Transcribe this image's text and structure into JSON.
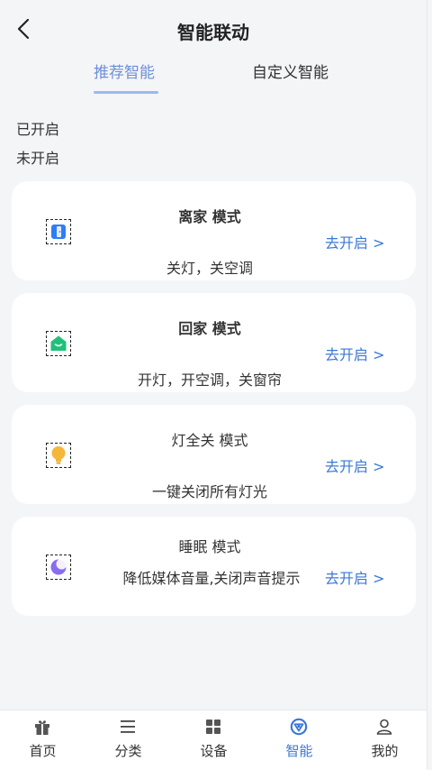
{
  "header": {
    "title": "智能联动",
    "back_icon": "chevron-left-icon"
  },
  "tabs": [
    {
      "label": "推荐智能",
      "active": true
    },
    {
      "label": "自定义智能",
      "active": false
    }
  ],
  "status": {
    "enabled": "已开启",
    "disabled": "未开启"
  },
  "modes": [
    {
      "name": "离家 模式",
      "desc": "关灯，关空调",
      "cta": "去开启 >",
      "icon": "exit-door-icon",
      "color": "#2f7df6"
    },
    {
      "name": "回家 模式",
      "desc": "开灯，开空调，关窗帘",
      "cta": "去开启 >",
      "icon": "home-icon",
      "color": "#21c07a"
    },
    {
      "name": "灯全关 模式",
      "desc": "一键关闭所有灯光",
      "cta": "去开启 >",
      "icon": "lightbulb-icon",
      "color": "#f5b63a"
    },
    {
      "name": "睡眠 模式",
      "desc": "降低媒体音量,关闭声音提示",
      "cta": "去开启 >",
      "icon": "moon-icon",
      "color": "#8a6cf0"
    }
  ],
  "tabbar": [
    {
      "label": "首页",
      "icon": "gift-icon",
      "active": false
    },
    {
      "label": "分类",
      "icon": "menu-icon",
      "active": false
    },
    {
      "label": "设备",
      "icon": "grid-icon",
      "active": false
    },
    {
      "label": "智能",
      "icon": "smart-icon",
      "active": true
    },
    {
      "label": "我的",
      "icon": "user-icon",
      "active": false
    }
  ],
  "colors": {
    "accent": "#3b78d8",
    "tab_active": "#6d8fd6",
    "background": "#f4f5f7"
  }
}
